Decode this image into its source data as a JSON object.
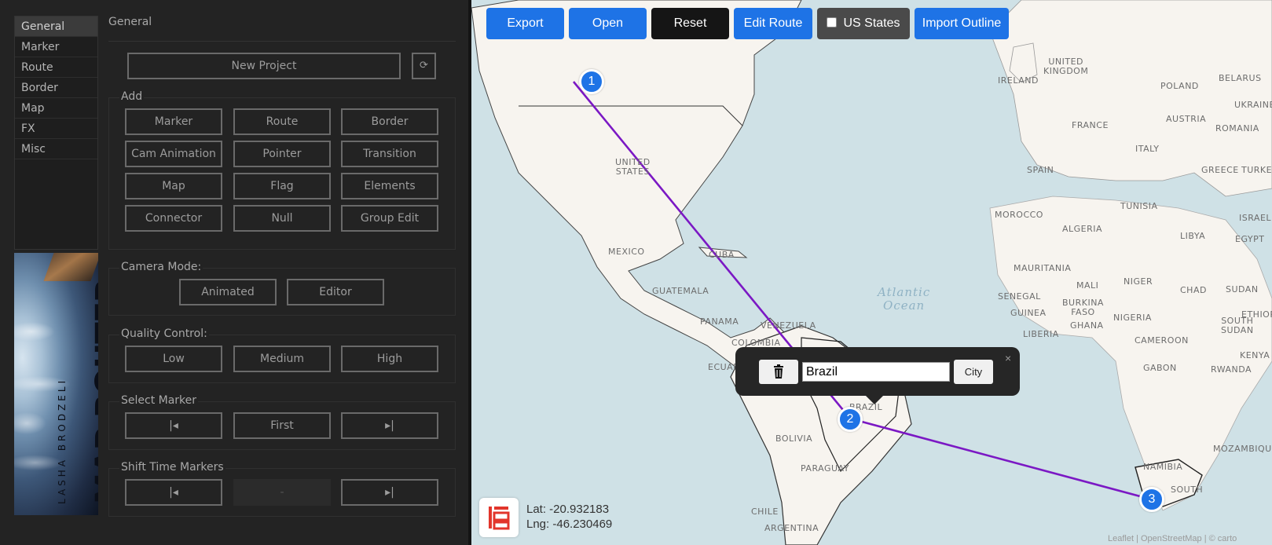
{
  "panel": {
    "section_title": "General",
    "nav": [
      "General",
      "Marker",
      "Route",
      "Border",
      "Map",
      "FX",
      "Misc"
    ],
    "logo": {
      "title": "MAP ROUTER",
      "author": "LASHA BRODZELI"
    },
    "new_project": "New Project",
    "refresh_icon": "⟳",
    "add": {
      "label": "Add",
      "buttons": [
        "Marker",
        "Route",
        "Border",
        "Cam Animation",
        "Pointer",
        "Transition",
        "Map",
        "Flag",
        "Elements",
        "Connector",
        "Null",
        "Group Edit"
      ]
    },
    "camera_mode": {
      "label": "Camera Mode:",
      "buttons": [
        "Animated",
        "Editor"
      ]
    },
    "quality_control": {
      "label": "Quality Control:",
      "buttons": [
        "Low",
        "Medium",
        "High"
      ]
    },
    "select_marker": {
      "label": "Select Marker",
      "buttons": [
        "|◂",
        "First",
        "▸|"
      ]
    },
    "shift_time_markers": {
      "label": "Shift Time Markers",
      "buttons": [
        "|◂",
        "-",
        "▸|"
      ]
    }
  },
  "map": {
    "toolbar": {
      "export": "Export",
      "open": "Open",
      "reset": "Reset",
      "edit_route": "Edit Route",
      "us_states": "US States",
      "us_states_checked": false,
      "import_outline": "Import Outline"
    },
    "markers": [
      "1",
      "2",
      "3"
    ],
    "route_color": "#7b18c4",
    "popup": {
      "value": "Brazil",
      "city_button": "City",
      "close": "×",
      "delete_icon": "trash-icon"
    },
    "coords": {
      "lat": "Lat: -20.932183",
      "lng": "Lng: -46.230469"
    },
    "attribution": "Leaflet | OpenStreetMap | © carto",
    "labels": {
      "united_kingdom": "UNITED\nKINGDOM",
      "ireland": "IRELAND",
      "belarus": "BELARUS",
      "poland": "POLAND",
      "ukraine": "UKRAINE",
      "austria": "AUSTRIA",
      "romania": "ROMANIA",
      "france": "FRANCE",
      "italy": "ITALY",
      "spain": "SPAIN",
      "greece": "GREECE",
      "turkey": "TURKEY",
      "morocco": "MOROCCO",
      "algeria": "ALGERIA",
      "tunisia": "TUNISIA",
      "libya": "LIBYA",
      "egypt": "EGYPT",
      "israel": "ISRAEL",
      "mauritania": "MAURITANIA",
      "mali": "MALI",
      "niger": "NIGER",
      "chad": "CHAD",
      "sudan": "SUDAN",
      "senegal": "SENEGAL",
      "guinea": "GUINEA",
      "burkina_faso": "BURKINA\nFASO",
      "nigeria": "NIGERIA",
      "ethiopia": "ETHIOPI",
      "south_sudan": "SOUTH\nSUDAN",
      "liberia": "LIBERIA",
      "ghana": "GHANA",
      "cameroon": "CAMEROON",
      "kenya": "KENYA",
      "gabon": "GABON",
      "rwanda": "RWANDA",
      "namibia": "NAMIBIA",
      "mozambique": "MOZAMBIQUE",
      "south_africa": "SOUTH",
      "united_states": "UNITED\nSTATES",
      "mexico": "MEXICO",
      "cuba": "CUBA",
      "guatemala": "GUATEMALA",
      "panama": "PANAMA",
      "venezuela": "VENEZUELA",
      "colombia": "COLOMBIA",
      "ecuador": "ECUADOR",
      "brazil": "BRAZIL",
      "bolivia": "BOLIVIA",
      "paraguay": "PARAGUAY",
      "chile": "CHILE",
      "argentina": "ARGENTINA",
      "atlantic_ocean": "Atlantic\nOcean"
    }
  }
}
